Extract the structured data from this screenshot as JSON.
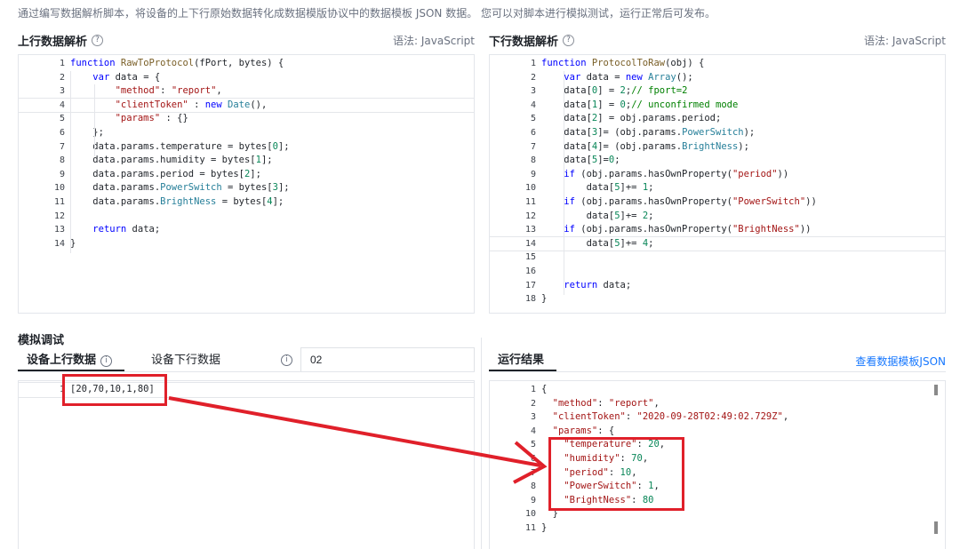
{
  "intro_text": "通过编写数据解析脚本，将设备的上下行原始数据转化成数据模版协议中的数据模板 JSON 数据。 您可以对脚本进行模拟测试，运行正常后可发布。",
  "uplink": {
    "title": "上行数据解析",
    "help_icon": "question-circle-icon",
    "language": "语法: JavaScript",
    "lines": [
      {
        "n": "1",
        "t": [
          [
            "k",
            "function "
          ],
          [
            "f",
            "RawToProtocol"
          ],
          [
            "",
            "(fPort, bytes) {"
          ]
        ]
      },
      {
        "n": "2",
        "t": [
          [
            "",
            "    "
          ],
          [
            "k",
            "var"
          ],
          [
            "",
            " data = {"
          ]
        ]
      },
      {
        "n": "3",
        "t": [
          [
            "",
            "        "
          ],
          [
            "s",
            "\"method\""
          ],
          [
            "",
            ": "
          ],
          [
            "s",
            "\"report\""
          ],
          [
            "",
            ","
          ]
        ]
      },
      {
        "n": "4",
        "t": [
          [
            "",
            "        "
          ],
          [
            "s",
            "\"clientToken\""
          ],
          [
            "",
            " : "
          ],
          [
            "k",
            "new "
          ],
          [
            "p",
            "Date"
          ],
          [
            "",
            "(),"
          ]
        ]
      },
      {
        "n": "5",
        "t": [
          [
            "",
            "        "
          ],
          [
            "s",
            "\"params\""
          ],
          [
            "",
            " : {}"
          ]
        ]
      },
      {
        "n": "6",
        "t": [
          [
            "",
            "    };"
          ]
        ]
      },
      {
        "n": "7",
        "t": [
          [
            "",
            "    data.params.temperature = bytes["
          ],
          [
            "n",
            "0"
          ],
          [
            "",
            "];"
          ]
        ]
      },
      {
        "n": "8",
        "t": [
          [
            "",
            "    data.params.humidity = bytes["
          ],
          [
            "n",
            "1"
          ],
          [
            "",
            "];"
          ]
        ]
      },
      {
        "n": "9",
        "t": [
          [
            "",
            "    data.params.period = bytes["
          ],
          [
            "n",
            "2"
          ],
          [
            "",
            "];"
          ]
        ]
      },
      {
        "n": "10",
        "t": [
          [
            "",
            "    data.params."
          ],
          [
            "p",
            "PowerSwitch"
          ],
          [
            "",
            " = bytes["
          ],
          [
            "n",
            "3"
          ],
          [
            "",
            "];"
          ]
        ]
      },
      {
        "n": "11",
        "t": [
          [
            "",
            "    data.params."
          ],
          [
            "p",
            "BrightNess"
          ],
          [
            "",
            " = bytes["
          ],
          [
            "n",
            "4"
          ],
          [
            "",
            "];"
          ]
        ]
      },
      {
        "n": "12",
        "t": [
          [
            "",
            ""
          ]
        ]
      },
      {
        "n": "13",
        "t": [
          [
            "",
            "    "
          ],
          [
            "k",
            "return"
          ],
          [
            "",
            " data;"
          ]
        ]
      },
      {
        "n": "14",
        "t": [
          [
            "",
            "}"
          ]
        ]
      }
    ]
  },
  "downlink": {
    "title": "下行数据解析",
    "help_icon": "question-circle-icon",
    "language": "语法: JavaScript",
    "lines": [
      {
        "n": "1",
        "t": [
          [
            "k",
            "function "
          ],
          [
            "f",
            "ProtocolToRaw"
          ],
          [
            "",
            "(obj) {"
          ]
        ]
      },
      {
        "n": "2",
        "t": [
          [
            "",
            "    "
          ],
          [
            "k",
            "var"
          ],
          [
            "",
            " data = "
          ],
          [
            "k",
            "new "
          ],
          [
            "p",
            "Array"
          ],
          [
            "",
            "();"
          ]
        ]
      },
      {
        "n": "3",
        "t": [
          [
            "",
            "    data["
          ],
          [
            "n",
            "0"
          ],
          [
            "",
            "] = "
          ],
          [
            "n",
            "2"
          ],
          [
            "",
            ";"
          ],
          [
            "c",
            "// fport=2"
          ]
        ]
      },
      {
        "n": "4",
        "t": [
          [
            "",
            "    data["
          ],
          [
            "n",
            "1"
          ],
          [
            "",
            "] = "
          ],
          [
            "n",
            "0"
          ],
          [
            "",
            ";"
          ],
          [
            "c",
            "// unconfirmed mode"
          ]
        ]
      },
      {
        "n": "5",
        "t": [
          [
            "",
            "    data["
          ],
          [
            "n",
            "2"
          ],
          [
            "",
            "] = obj.params.period;"
          ]
        ]
      },
      {
        "n": "6",
        "t": [
          [
            "",
            "    data["
          ],
          [
            "n",
            "3"
          ],
          [
            "",
            "]= (obj.params."
          ],
          [
            "p",
            "PowerSwitch"
          ],
          [
            "",
            ");"
          ]
        ]
      },
      {
        "n": "7",
        "t": [
          [
            "",
            "    data["
          ],
          [
            "n",
            "4"
          ],
          [
            "",
            "]= (obj.params."
          ],
          [
            "p",
            "BrightNess"
          ],
          [
            "",
            ");"
          ]
        ]
      },
      {
        "n": "8",
        "t": [
          [
            "",
            "    data["
          ],
          [
            "n",
            "5"
          ],
          [
            "",
            "]="
          ],
          [
            "n",
            "0"
          ],
          [
            "",
            ";"
          ]
        ]
      },
      {
        "n": "9",
        "t": [
          [
            "",
            "    "
          ],
          [
            "k",
            "if"
          ],
          [
            "",
            " (obj.params.hasOwnProperty("
          ],
          [
            "s",
            "\"period\""
          ],
          [
            "",
            "))"
          ]
        ]
      },
      {
        "n": "10",
        "t": [
          [
            "",
            "        data["
          ],
          [
            "n",
            "5"
          ],
          [
            "",
            "]+= "
          ],
          [
            "n",
            "1"
          ],
          [
            "",
            ";"
          ]
        ]
      },
      {
        "n": "11",
        "t": [
          [
            "",
            "    "
          ],
          [
            "k",
            "if"
          ],
          [
            "",
            " (obj.params.hasOwnProperty("
          ],
          [
            "s",
            "\"PowerSwitch\""
          ],
          [
            "",
            "))"
          ]
        ]
      },
      {
        "n": "12",
        "t": [
          [
            "",
            "        data["
          ],
          [
            "n",
            "5"
          ],
          [
            "",
            "]+= "
          ],
          [
            "n",
            "2"
          ],
          [
            "",
            ";"
          ]
        ]
      },
      {
        "n": "13",
        "t": [
          [
            "",
            "    "
          ],
          [
            "k",
            "if"
          ],
          [
            "",
            " (obj.params.hasOwnProperty("
          ],
          [
            "s",
            "\"BrightNess\""
          ],
          [
            "",
            "))"
          ]
        ]
      },
      {
        "n": "14",
        "t": [
          [
            "",
            "        data["
          ],
          [
            "n",
            "5"
          ],
          [
            "",
            "]+= "
          ],
          [
            "n",
            "4"
          ],
          [
            "",
            ";"
          ]
        ]
      },
      {
        "n": "15",
        "t": [
          [
            "",
            ""
          ]
        ]
      },
      {
        "n": "16",
        "t": [
          [
            "",
            ""
          ]
        ]
      },
      {
        "n": "17",
        "t": [
          [
            "",
            "    "
          ],
          [
            "k",
            "return"
          ],
          [
            "",
            " data;"
          ]
        ]
      },
      {
        "n": "18",
        "t": [
          [
            "",
            "}"
          ]
        ]
      }
    ]
  },
  "simulate": {
    "title": "模拟调试",
    "tab_uplink": "设备上行数据",
    "tab_downlink": "设备下行数据",
    "info_icon": "info-circle-icon",
    "port_value": "02",
    "input_lines": [
      {
        "n": "1",
        "t": [
          [
            "",
            "[20,70,10,1,80]"
          ]
        ]
      }
    ]
  },
  "result": {
    "title": "运行结果",
    "view_template_link": "查看数据模板JSON",
    "lines": [
      {
        "n": "1",
        "t": [
          [
            "",
            "{"
          ]
        ]
      },
      {
        "n": "2",
        "t": [
          [
            "",
            "  "
          ],
          [
            "jk",
            "\"method\""
          ],
          [
            "",
            ": "
          ],
          [
            "s",
            "\"report\""
          ],
          [
            "",
            ","
          ]
        ]
      },
      {
        "n": "3",
        "t": [
          [
            "",
            "  "
          ],
          [
            "jk",
            "\"clientToken\""
          ],
          [
            "",
            ": "
          ],
          [
            "s",
            "\"2020-09-28T02:49:02.729Z\""
          ],
          [
            "",
            ","
          ]
        ]
      },
      {
        "n": "4",
        "t": [
          [
            "",
            "  "
          ],
          [
            "jk",
            "\"params\""
          ],
          [
            "",
            ": {"
          ]
        ]
      },
      {
        "n": "5",
        "t": [
          [
            "",
            "    "
          ],
          [
            "jk",
            "\"temperature\""
          ],
          [
            "",
            ": "
          ],
          [
            "n",
            "20"
          ],
          [
            "",
            ","
          ]
        ]
      },
      {
        "n": "6",
        "t": [
          [
            "",
            "    "
          ],
          [
            "jk",
            "\"humidity\""
          ],
          [
            "",
            ": "
          ],
          [
            "n",
            "70"
          ],
          [
            "",
            ","
          ]
        ]
      },
      {
        "n": "7",
        "t": [
          [
            "",
            "    "
          ],
          [
            "jk",
            "\"period\""
          ],
          [
            "",
            ": "
          ],
          [
            "n",
            "10"
          ],
          [
            "",
            ","
          ]
        ]
      },
      {
        "n": "8",
        "t": [
          [
            "",
            "    "
          ],
          [
            "jk",
            "\"PowerSwitch\""
          ],
          [
            "",
            ": "
          ],
          [
            "n",
            "1"
          ],
          [
            "",
            ","
          ]
        ]
      },
      {
        "n": "9",
        "t": [
          [
            "",
            "    "
          ],
          [
            "jk",
            "\"BrightNess\""
          ],
          [
            "",
            ": "
          ],
          [
            "n",
            "80"
          ]
        ]
      },
      {
        "n": "10",
        "t": [
          [
            "",
            "  }"
          ]
        ]
      },
      {
        "n": "11",
        "t": [
          [
            "",
            "}"
          ]
        ]
      }
    ]
  },
  "annotation": {
    "callout_color": "#e0202a"
  }
}
